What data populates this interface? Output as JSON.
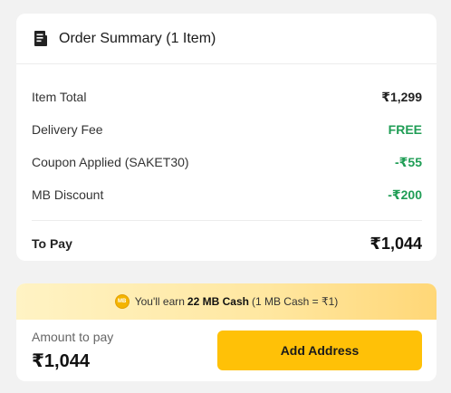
{
  "summary": {
    "title": "Order Summary (1 Item)",
    "icon": "receipt-icon",
    "rows": [
      {
        "label": "Item Total",
        "value": "₹1,299"
      },
      {
        "label": "Delivery Fee",
        "value": "FREE"
      },
      {
        "label": "Coupon Applied (SAKET30)",
        "value": "-₹55"
      },
      {
        "label": "MB Discount",
        "value": "-₹200"
      }
    ],
    "total_label": "To Pay",
    "total_value": "₹1,044"
  },
  "banner": {
    "coin_text": "MB",
    "text_before": "You'll earn",
    "highlight": "22 MB Cash",
    "text_after": "(1 MB Cash = ₹1)"
  },
  "footer": {
    "amount_label": "Amount to pay",
    "amount_value": "₹1,044",
    "button_label": "Add Address"
  },
  "colors": {
    "accent": "#ffc107",
    "green": "#1f9d55",
    "background": "#f2f2f2"
  }
}
